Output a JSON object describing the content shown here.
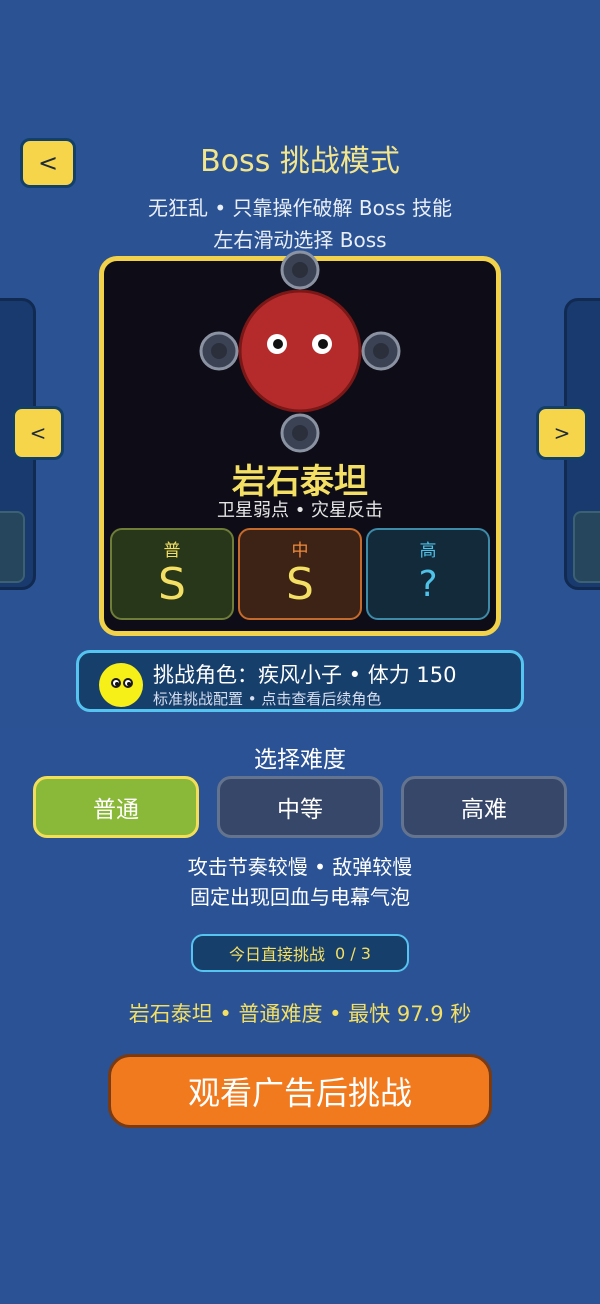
{
  "header": {
    "back_label": "<",
    "title": "Boss 挑战模式",
    "subtitle_line1": "无狂乱 • 只靠操作破解 Boss 技能",
    "subtitle_line2": "左右滑动选择 Boss"
  },
  "carousel": {
    "left_arrow": "<",
    "right_arrow": ">"
  },
  "boss": {
    "name": "岩石泰坦",
    "tags": "卫星弱点 • 灾星反击",
    "body_color": "#b52b2b",
    "grades": [
      {
        "label": "普",
        "value": "S",
        "color": "#f3df63"
      },
      {
        "label": "中",
        "value": "S",
        "color": "#f3df63"
      },
      {
        "label": "高",
        "value": "?",
        "color": "#4fc2e8"
      }
    ]
  },
  "challenger": {
    "line1": "挑战角色：疾风小子 • 体力 150",
    "line2": "标准挑战配置 • 点击查看后续角色",
    "face_color": "#f7f018"
  },
  "difficulty": {
    "title": "选择难度",
    "options": [
      "普通",
      "中等",
      "高难"
    ],
    "selected": "普通",
    "desc_line1": "攻击节奏较慢 • 敌弹较慢",
    "desc_line2": "固定出现回血与电幕气泡"
  },
  "daily": {
    "label": "今日直接挑战",
    "count": "0 / 3"
  },
  "record": "岩石泰坦 • 普通难度 • 最快 97.9 秒",
  "cta_label": "观看广告后挑战",
  "colors": {
    "background": "#2b5393",
    "accent_yellow": "#f6d54a",
    "cta_orange": "#f17a1f",
    "selected_green": "#8ab838"
  }
}
